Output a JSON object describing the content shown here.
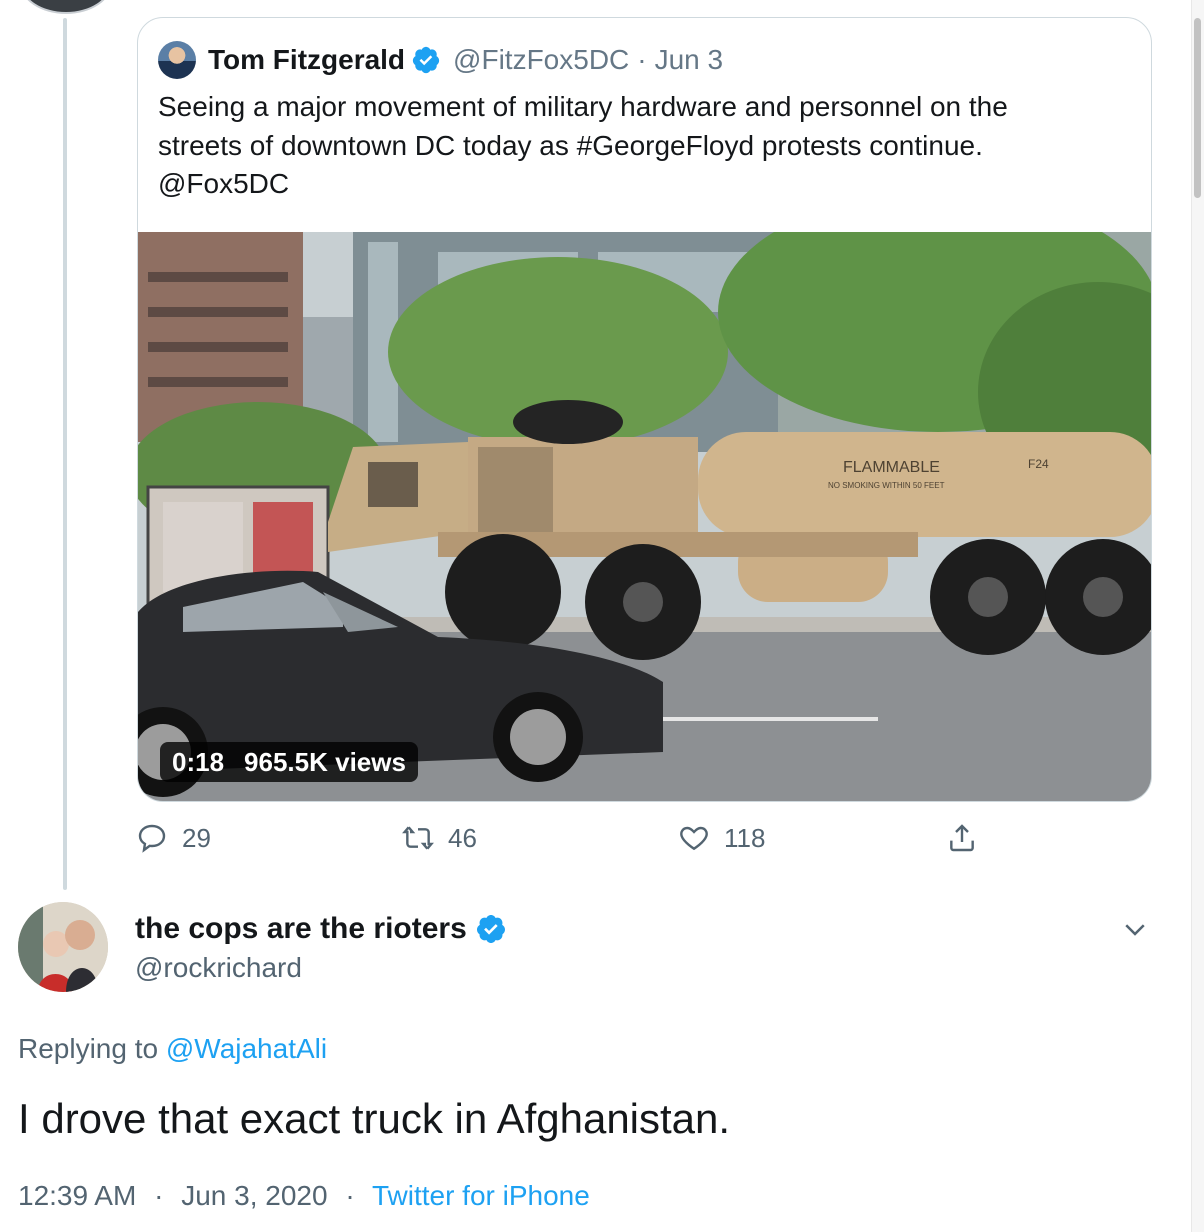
{
  "quoted_tweet": {
    "author_name": "Tom Fitzgerald",
    "verified": true,
    "handle": "@FitzFox5DC",
    "date": "Jun 3",
    "text": "Seeing a major movement of military hardware and personnel on the\nstreets of downtown DC today as #GeorgeFloyd protests continue.\n@Fox5DC",
    "video": {
      "duration": "0:18",
      "views": "965.5K views",
      "truck_text": "FLAMMABLE",
      "truck_subtext": "NO SMOKING WITHIN 50 FEET",
      "truck_code": "F24"
    },
    "actions": {
      "replies": "29",
      "retweets": "46",
      "likes": "118"
    }
  },
  "reply_tweet": {
    "author_name": "the cops are the rioters",
    "verified": true,
    "handle": "@rockrichard",
    "replying_prefix": "Replying to",
    "replying_to": "@WajahatAli",
    "text": "I drove that exact truck in Afghanistan.",
    "time": "12:39 AM",
    "date": "Jun 3, 2020",
    "source": "Twitter for iPhone"
  },
  "colors": {
    "accent": "#1da1f2",
    "muted": "#536471",
    "border": "#cfd9de"
  },
  "icons": [
    "reply-icon",
    "retweet-icon",
    "like-icon",
    "share-icon",
    "verified-icon",
    "chevron-down-icon"
  ]
}
